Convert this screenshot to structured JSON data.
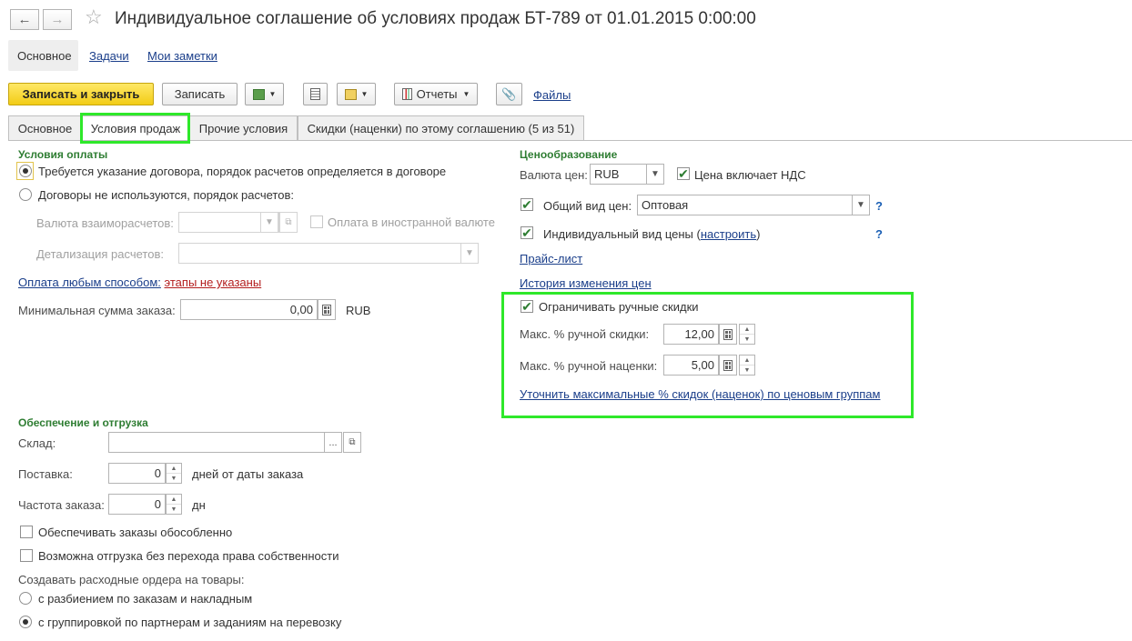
{
  "window": {
    "title": "Индивидуальное соглашение об условиях продаж БТ-789 от 01.01.2015 0:00:00",
    "back_icon": "arrow-left-icon",
    "forward_icon": "arrow-right-icon",
    "favorite_icon": "star-icon"
  },
  "nav": {
    "items": [
      "Основное",
      "Задачи",
      "Мои заметки"
    ]
  },
  "toolbar": {
    "save_close": "Записать и закрыть",
    "save": "Записать",
    "reports": "Отчеты",
    "files": "Файлы"
  },
  "tabs": [
    "Основное",
    "Условия продаж",
    "Прочие условия",
    "Скидки (наценки) по этому соглашению (5 из 51)"
  ],
  "payment": {
    "section_title": "Условия оплаты",
    "option1": "Требуется указание договора, порядок расчетов определяется в договоре",
    "option2": "Договоры не используются, порядок расчетов:",
    "currency_label": "Валюта взаиморасчетов:",
    "currency_value": "",
    "foreign_currency_label": "Оплата в иностранной валюте",
    "detail_label": "Детализация расчетов:",
    "detail_value": "",
    "any_method_link": "Оплата любым способом:",
    "stages_link": "этапы не указаны",
    "min_sum_label": "Минимальная сумма заказа:",
    "min_sum_value": "0,00",
    "min_sum_currency": "RUB"
  },
  "pricing": {
    "section_title": "Ценообразование",
    "currency_label": "Валюта цен:",
    "currency_value": "RUB",
    "vat_label": "Цена включает НДС",
    "vat_checked": true,
    "common_price_label": "Общий вид цен:",
    "common_price_checked": true,
    "common_price_value": "Оптовая",
    "individual_price_label_before": "Индивидуальный вид цены (",
    "individual_price_link": "настроить",
    "individual_price_label_after": ")",
    "individual_price_checked": true,
    "help_mark": "?",
    "price_list_link": "Прайс-лист",
    "history_link": "История изменения цен"
  },
  "manual_discounts": {
    "limit_label": "Ограничивать ручные скидки",
    "limit_checked": true,
    "max_discount_label": "Макс. % ручной скидки:",
    "max_discount_value": "12,00",
    "max_markup_label": "Макс. % ручной наценки:",
    "max_markup_value": "5,00",
    "refine_link": "Уточнить максимальные % скидок (наценок) по ценовым группам"
  },
  "shipping": {
    "section_title": "Обеспечение и отгрузка",
    "warehouse_label": "Склад:",
    "warehouse_value": "",
    "ellipsis": "...",
    "delivery_label": "Поставка:",
    "delivery_value": "0",
    "delivery_unit": "дней от даты заказа",
    "frequency_label": "Частота заказа:",
    "frequency_value": "0",
    "frequency_unit": "дн",
    "separate_label": "Обеспечивать заказы обособленно",
    "separate_checked": false,
    "no_ownership_label": "Возможна отгрузка без перехода права собственности",
    "no_ownership_checked": false,
    "orders_title": "Создавать расходные ордера на товары:",
    "orders_option1": "с разбиением по заказам и накладным",
    "orders_option2": "с группировкой по партнерам и заданиям на перевозку",
    "orders_selected": 2
  },
  "colors": {
    "accent_yellow": "#f2cc16",
    "section_green": "#2e7d32",
    "highlight_green": "#2ee82a",
    "link_blue": "#1a3e8a"
  }
}
